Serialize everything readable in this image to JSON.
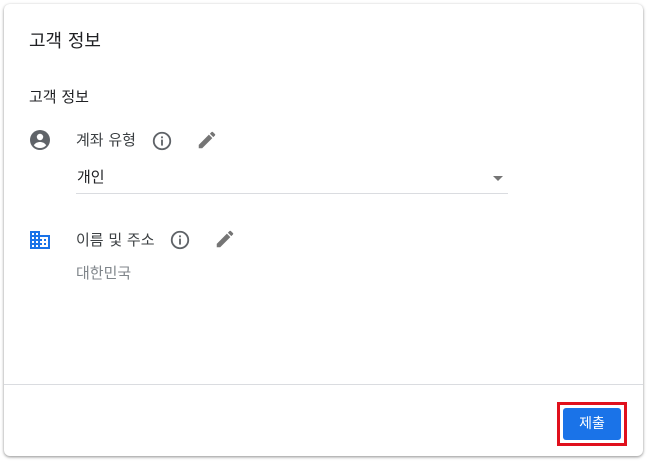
{
  "dialog": {
    "title": "고객 정보"
  },
  "section": {
    "title": "고객 정보"
  },
  "account_type": {
    "label": "계좌 유형",
    "icon": "account-circle-icon",
    "selected_value": "개인"
  },
  "address": {
    "label": "이름 및 주소",
    "icon": "business-icon",
    "value": "대한민국"
  },
  "footer": {
    "submit_label": "제출"
  },
  "colors": {
    "accent": "#1a73e8",
    "highlight": "#e0101c",
    "icon_grey": "#5f6368"
  }
}
